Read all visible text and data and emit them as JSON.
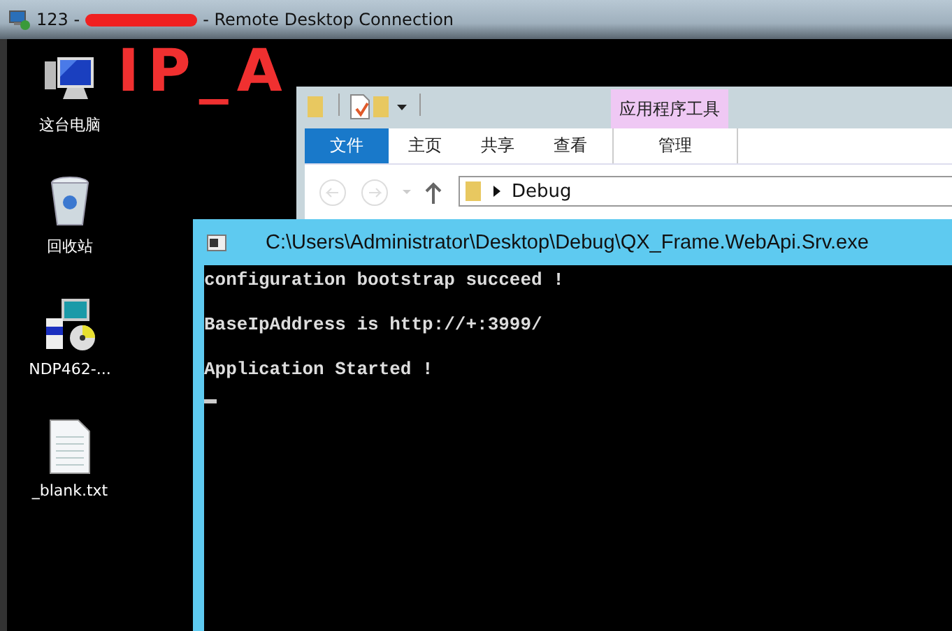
{
  "remote_window": {
    "title_prefix": "123 -",
    "title_suffix": "- Remote Desktop Connection"
  },
  "annotation": "IP_A",
  "desktop_icons": [
    {
      "label": "这台电脑",
      "kind": "computer"
    },
    {
      "label": "回收站",
      "kind": "recycle"
    },
    {
      "label": "NDP462-...",
      "kind": "installer"
    },
    {
      "label": "_blank.txt",
      "kind": "textfile"
    }
  ],
  "explorer": {
    "context_group": "应用程序工具",
    "tabs": [
      {
        "label": "文件",
        "kind": "file"
      },
      {
        "label": "主页",
        "kind": "normal"
      },
      {
        "label": "共享",
        "kind": "normal"
      },
      {
        "label": "查看",
        "kind": "normal"
      },
      {
        "label": "管理",
        "kind": "context"
      }
    ],
    "address": "Debug"
  },
  "console": {
    "title": "C:\\Users\\Administrator\\Desktop\\Debug\\QX_Frame.WebApi.Srv.exe",
    "lines": [
      "configuration bootstrap succeed !",
      "BaseIpAddress is http://+:3999/",
      "Application Started !"
    ]
  }
}
